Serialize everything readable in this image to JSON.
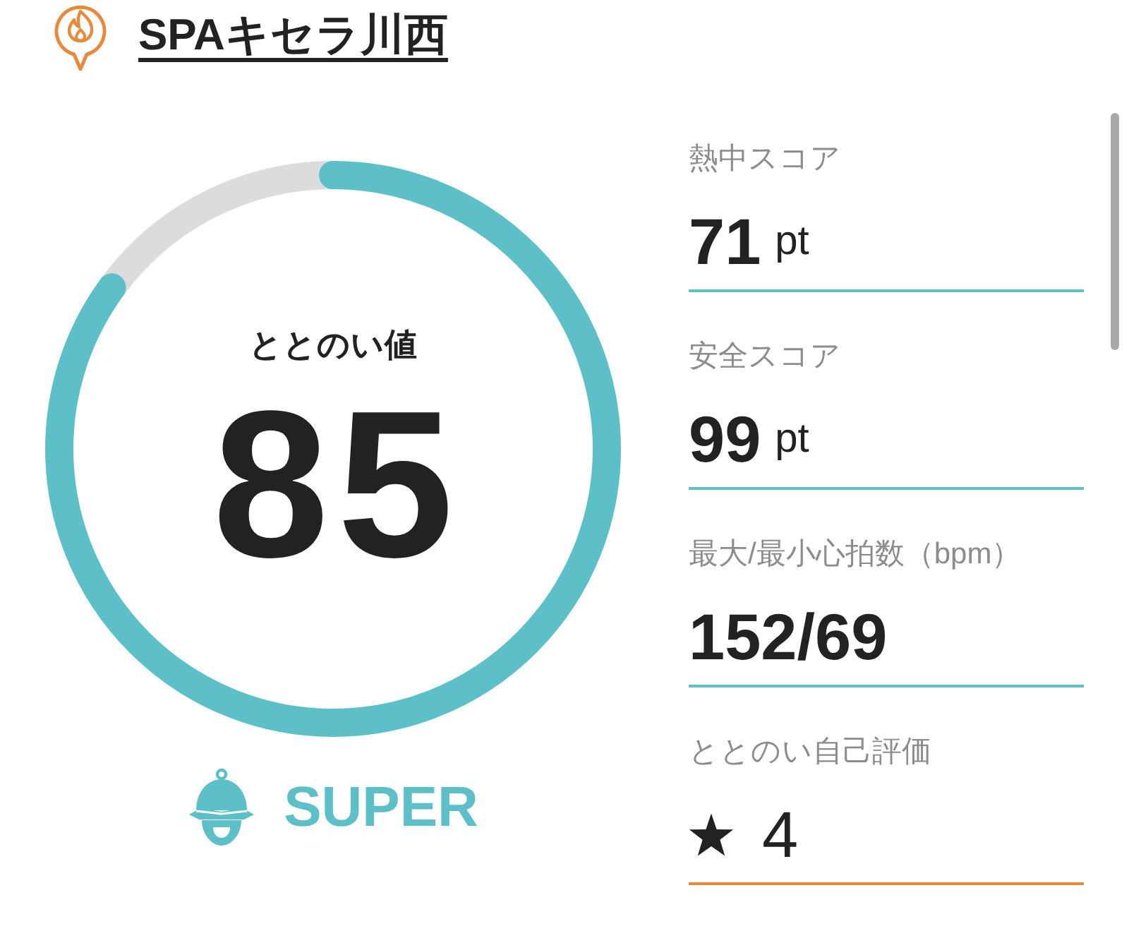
{
  "header": {
    "title": "SPAキセラ川西"
  },
  "score": {
    "label": "ととのい値",
    "value": "85",
    "level": 0.85,
    "rank": "SUPER"
  },
  "metrics": [
    {
      "kind": "number",
      "label": "熱中スコア",
      "value": "71",
      "unit": "pt",
      "color": "#5dbfc7"
    },
    {
      "kind": "number",
      "label": "安全スコア",
      "value": "99",
      "unit": "pt",
      "color": "#5dbfc7"
    },
    {
      "kind": "number",
      "label": "最大/最小心拍数（bpm）",
      "value": "152/69",
      "color": "#5dbfc7"
    },
    {
      "kind": "rating",
      "label": "ととのい自己評価",
      "value": "4",
      "color": "#e8893b"
    }
  ]
}
